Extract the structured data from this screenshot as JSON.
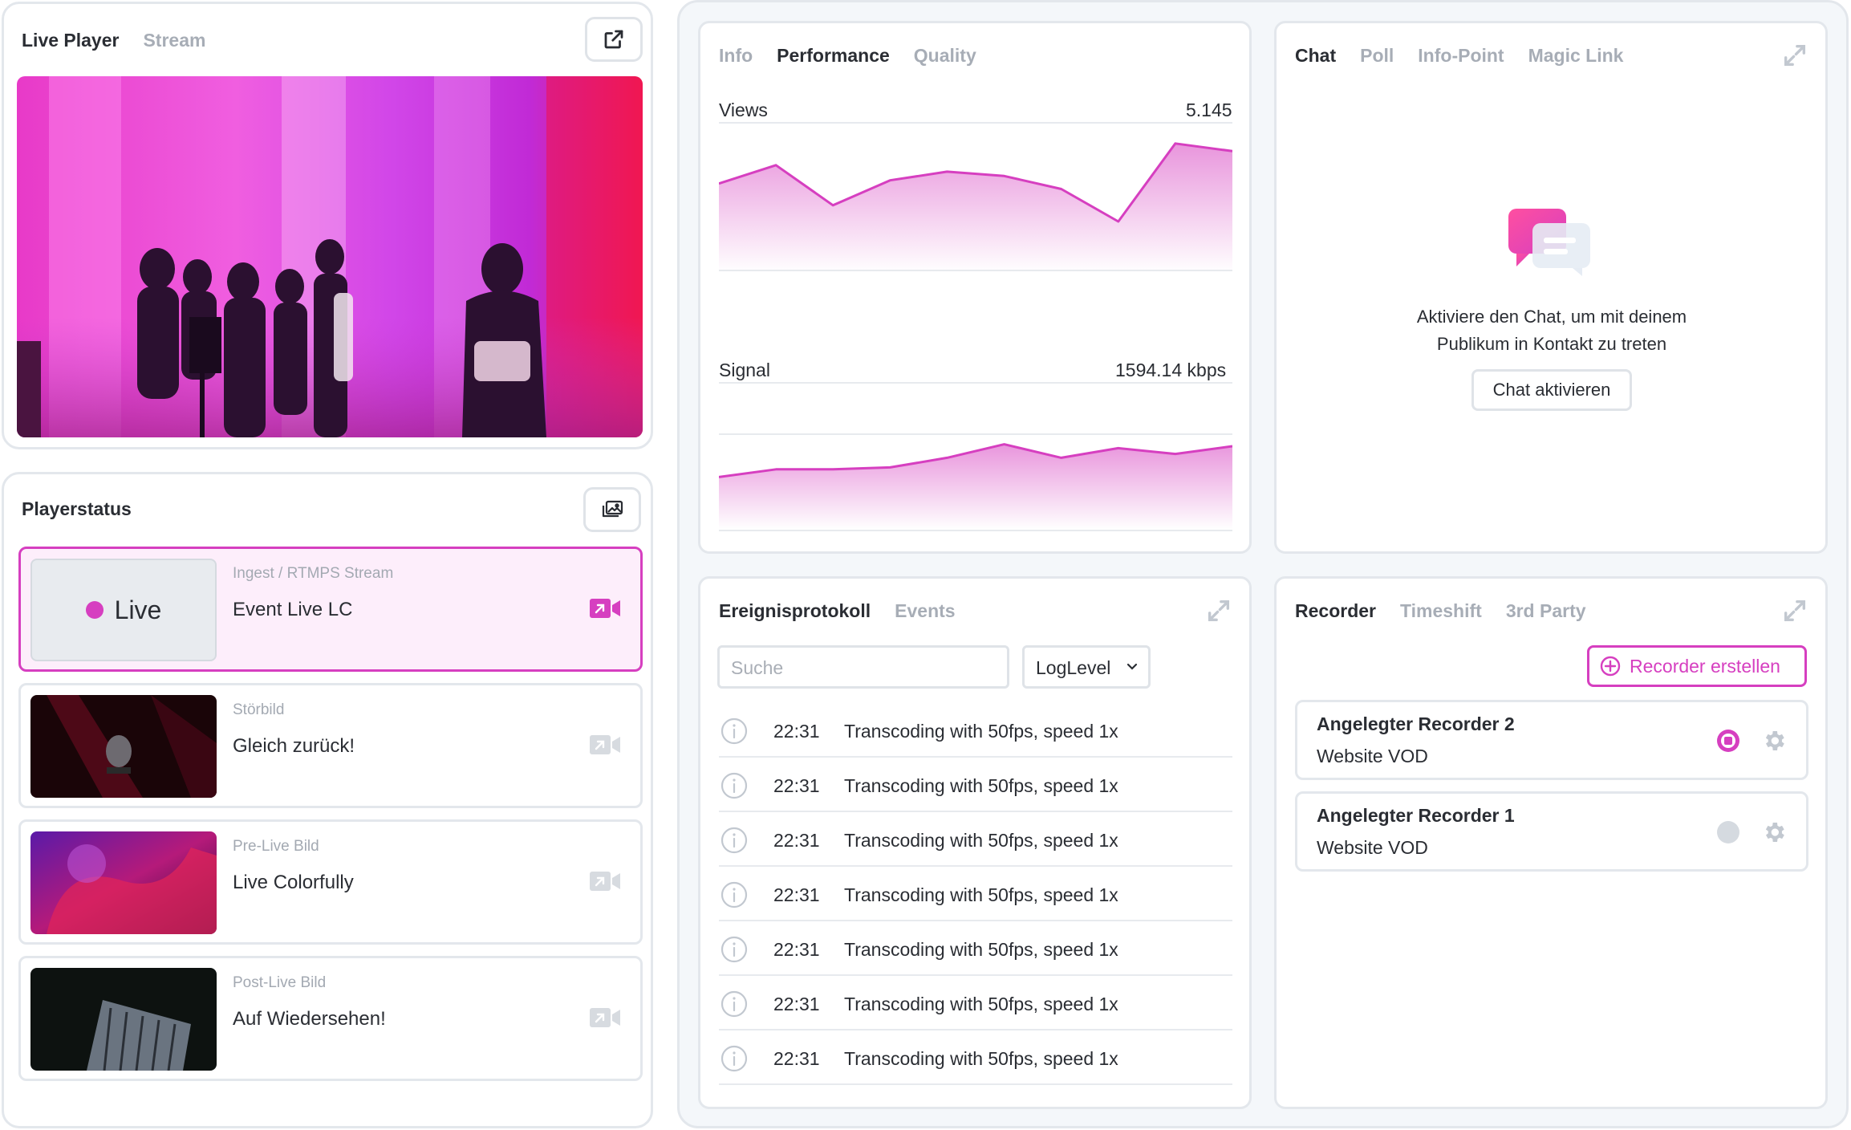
{
  "live_player": {
    "tabs": [
      "Live Player",
      "Stream"
    ],
    "active_tab": 0,
    "popout_icon": "external-link-icon"
  },
  "playerstatus": {
    "title": "Playerstatus",
    "media_icon": "image-gallery-icon",
    "rows": [
      {
        "sub": "Ingest / RTMPS Stream",
        "title": "Event Live LC",
        "badge": "Live",
        "active": true
      },
      {
        "sub": "Störbild",
        "title": "Gleich zurück!",
        "active": false
      },
      {
        "sub": "Pre-Live Bild",
        "title": "Live Colorfully",
        "active": false
      },
      {
        "sub": "Post-Live Bild",
        "title": "Auf Wiedersehen!",
        "active": false
      }
    ]
  },
  "performance": {
    "tabs": [
      "Info",
      "Performance",
      "Quality"
    ],
    "active_tab": 1,
    "views": {
      "label": "Views",
      "value": "5.145",
      "points": [
        0.55,
        0.72,
        0.35,
        0.58,
        0.66,
        0.62,
        0.5,
        0.2,
        0.92,
        0.85
      ]
    },
    "signal": {
      "label": "Signal",
      "value": "1594.14 kbps",
      "points": [
        0.28,
        0.36,
        0.36,
        0.38,
        0.48,
        0.62,
        0.48,
        0.58,
        0.52,
        0.6
      ]
    }
  },
  "chat": {
    "tabs": [
      "Chat",
      "Poll",
      "Info-Point",
      "Magic Link"
    ],
    "active_tab": 0,
    "message_line1": "Aktiviere den Chat, um mit deinem",
    "message_line2": "Publikum in Kontakt zu treten",
    "button": "Chat aktivieren"
  },
  "events": {
    "tabs": [
      "Ereignisprotokoll",
      "Events"
    ],
    "active_tab": 0,
    "search_placeholder": "Suche",
    "loglevel": "LogLevel",
    "rows": [
      {
        "time": "22:31",
        "msg": "Transcoding with 50fps, speed 1x"
      },
      {
        "time": "22:31",
        "msg": "Transcoding with 50fps, speed 1x"
      },
      {
        "time": "22:31",
        "msg": "Transcoding with 50fps, speed 1x"
      },
      {
        "time": "22:31",
        "msg": "Transcoding with 50fps, speed 1x"
      },
      {
        "time": "22:31",
        "msg": "Transcoding with 50fps, speed 1x"
      },
      {
        "time": "22:31",
        "msg": "Transcoding with 50fps, speed 1x"
      },
      {
        "time": "22:31",
        "msg": "Transcoding with 50fps, speed 1x"
      }
    ]
  },
  "recorder": {
    "tabs": [
      "Recorder",
      "Timeshift",
      "3rd Party"
    ],
    "active_tab": 0,
    "create_button": "Recorder erstellen",
    "items": [
      {
        "name": "Angelegter Recorder 2",
        "sub": "Website VOD",
        "status": "recording"
      },
      {
        "name": "Angelegter Recorder 1",
        "sub": "Website VOD",
        "status": "idle"
      }
    ]
  },
  "colors": {
    "accent": "#d63fc0",
    "border": "#e3e7ec",
    "muted": "#a7adb6"
  }
}
